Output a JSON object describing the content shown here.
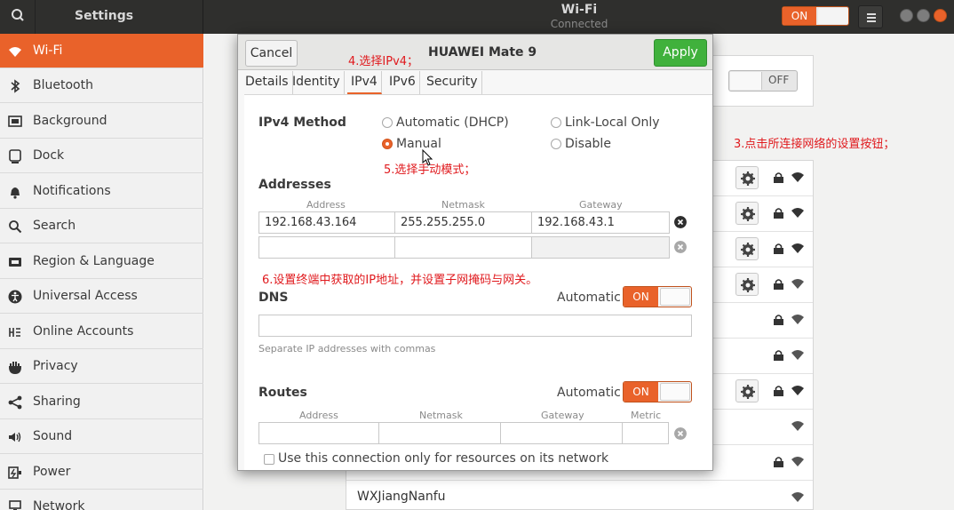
{
  "topbar": {
    "title": "Settings",
    "center_title": "Wi-Fi",
    "center_subtitle": "Connected",
    "wifi_switch": "ON",
    "icons": [
      "search-icon",
      "menu-icon",
      "minimize-icon",
      "maximize-icon",
      "close-icon"
    ]
  },
  "sidebar": {
    "items": [
      {
        "label": "Wi-Fi",
        "icon": "wifi-icon",
        "active": true
      },
      {
        "label": "Bluetooth",
        "icon": "bluetooth-icon"
      },
      {
        "label": "Background",
        "icon": "background-icon"
      },
      {
        "label": "Dock",
        "icon": "dock-icon"
      },
      {
        "label": "Notifications",
        "icon": "bell-icon"
      },
      {
        "label": "Search",
        "icon": "search-icon"
      },
      {
        "label": "Region & Language",
        "icon": "region-icon"
      },
      {
        "label": "Universal Access",
        "icon": "accessibility-icon"
      },
      {
        "label": "Online Accounts",
        "icon": "accounts-icon"
      },
      {
        "label": "Privacy",
        "icon": "hand-icon"
      },
      {
        "label": "Sharing",
        "icon": "share-icon"
      },
      {
        "label": "Sound",
        "icon": "speaker-icon"
      },
      {
        "label": "Power",
        "icon": "power-icon"
      },
      {
        "label": "Network",
        "icon": "network-icon"
      }
    ]
  },
  "background": {
    "airplane_switch": "OFF",
    "last_network": "WXJiangNanfu"
  },
  "dialog": {
    "cancel": "Cancel",
    "title": "HUAWEI Mate 9",
    "apply": "Apply",
    "tabs": [
      "Details",
      "Identity",
      "IPv4",
      "IPv6",
      "Security"
    ],
    "ipv4_method_label": "IPv4 Method",
    "methods": {
      "automatic": "Automatic (DHCP)",
      "link_local": "Link-Local Only",
      "manual": "Manual",
      "disable": "Disable"
    },
    "addresses_label": "Addresses",
    "address_headers": {
      "address": "Address",
      "netmask": "Netmask",
      "gateway": "Gateway"
    },
    "address_row": {
      "address": "192.168.43.164",
      "netmask": "255.255.255.0",
      "gateway": "192.168.43.1"
    },
    "dns_label": "DNS",
    "automatic": "Automatic",
    "on": "ON",
    "dns_hint": "Separate IP addresses with commas",
    "routes_label": "Routes",
    "route_headers": {
      "address": "Address",
      "netmask": "Netmask",
      "gateway": "Gateway",
      "metric": "Metric"
    },
    "only_resources": "Use this connection only for resources on its network"
  },
  "annotations": {
    "a3": "3.点击所连接网络的设置按钮；",
    "a4": "4.选择IPv4；",
    "a5": "5.选择手动模式；",
    "a6": "6.设置终端中获取的IP地址，并设置子网掩码与网关。"
  }
}
